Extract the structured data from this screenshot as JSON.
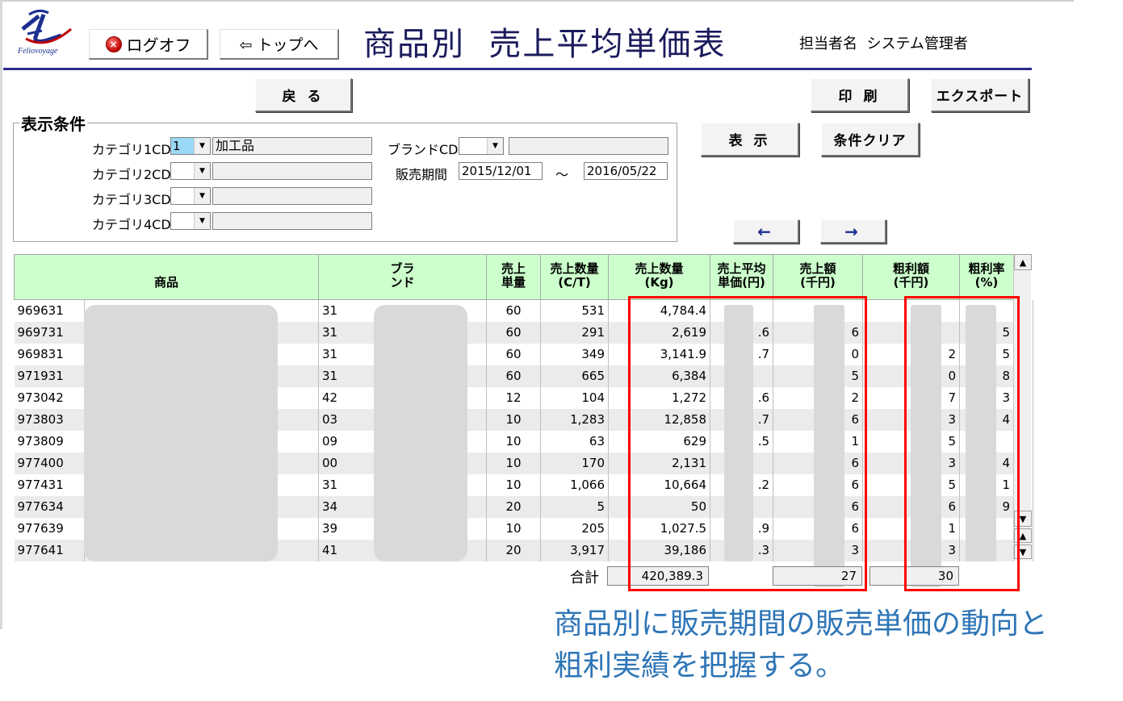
{
  "header": {
    "logo_text": "Feliovoyage",
    "logoff_label": "ログオフ",
    "top_label": "⇦ トップへ",
    "title": "商品別  売上平均単価表",
    "user_label": "担当者名  システム管理者"
  },
  "buttons": {
    "back": "戻 る",
    "print": "印 刷",
    "export": "エクスポート",
    "display": "表 示",
    "clear": "条件クリア",
    "prev": "←",
    "next": "→"
  },
  "filters": {
    "legend": "表示条件",
    "cat1_label": "カテゴリ1CD",
    "cat1_value": "1",
    "cat1_name": "加工品",
    "cat2_label": "カテゴリ2CD",
    "cat3_label": "カテゴリ3CD",
    "cat4_label": "カテゴリ4CD",
    "brand_label": "ブランドCD",
    "period_label": "販売期間",
    "period_from": "2015/12/01",
    "period_sep": "～",
    "period_to": "2016/05/22"
  },
  "table": {
    "headers": [
      "商品",
      "ブラ\nンド",
      "売上\n単量",
      "売上数量\n(C/T)",
      "売上数量\n(Kg)",
      "売上平均\n単価(円)",
      "売上額\n(千円)",
      "粗利額\n(千円)",
      "粗利率\n(%)"
    ],
    "rows": [
      {
        "code": "969631",
        "brand": "31",
        "unit": "60",
        "ct": "531",
        "kg": "4,784.4",
        "avg": "",
        "amt": "",
        "gp": "",
        "gpr": ""
      },
      {
        "code": "969731",
        "brand": "31",
        "unit": "60",
        "ct": "291",
        "kg": "2,619",
        "avg": ".6",
        "amt": "6",
        "gp": "",
        "gpr": "5"
      },
      {
        "code": "969831",
        "brand": "31",
        "unit": "60",
        "ct": "349",
        "kg": "3,141.9",
        "avg": ".7",
        "amt": "0",
        "gp": "2",
        "gpr": "5"
      },
      {
        "code": "971931",
        "brand": "31",
        "unit": "60",
        "ct": "665",
        "kg": "6,384",
        "avg": "",
        "amt": "5",
        "gp": "0",
        "gpr": "8"
      },
      {
        "code": "973042",
        "brand": "42",
        "unit": "12",
        "ct": "104",
        "kg": "1,272",
        "avg": ".6",
        "amt": "2",
        "gp": "7",
        "gpr": "3"
      },
      {
        "code": "973803",
        "brand": "03",
        "unit": "10",
        "ct": "1,283",
        "kg": "12,858",
        "avg": ".7",
        "amt": "6",
        "gp": "3",
        "gpr": "4"
      },
      {
        "code": "973809",
        "brand": "09",
        "unit": "10",
        "ct": "63",
        "kg": "629",
        "avg": ".5",
        "amt": "1",
        "gp": "5",
        "gpr": ""
      },
      {
        "code": "977400",
        "brand": "00",
        "unit": "10",
        "ct": "170",
        "kg": "2,131",
        "avg": "",
        "amt": "6",
        "gp": "3",
        "gpr": "4"
      },
      {
        "code": "977431",
        "brand": "31",
        "unit": "10",
        "ct": "1,066",
        "kg": "10,664",
        "avg": ".2",
        "amt": "6",
        "gp": "5",
        "gpr": "1"
      },
      {
        "code": "977634",
        "brand": "34",
        "unit": "20",
        "ct": "5",
        "kg": "50",
        "avg": "",
        "amt": "6",
        "gp": "6",
        "gpr": "9"
      },
      {
        "code": "977639",
        "brand": "39",
        "unit": "10",
        "ct": "205",
        "kg": "1,027.5",
        "avg": ".9",
        "amt": "6",
        "gp": "1",
        "gpr": ""
      },
      {
        "code": "977641",
        "brand": "41",
        "unit": "20",
        "ct": "3,917",
        "kg": "39,186",
        "avg": ".3",
        "amt": "3",
        "gp": "3",
        "gpr": ""
      }
    ]
  },
  "totals": {
    "label": "合計",
    "kg": "420,389.3",
    "amt": "27",
    "gp": "30"
  },
  "annotation": {
    "line1": "商品別に販売期間の販売単価の動向と",
    "line2": "粗利実績を把握する。"
  },
  "colors": {
    "header_bg": "#ccffcc",
    "highlight": "#ff0000",
    "annotation": "#2e75b6",
    "rule": "#2c2c8c"
  }
}
